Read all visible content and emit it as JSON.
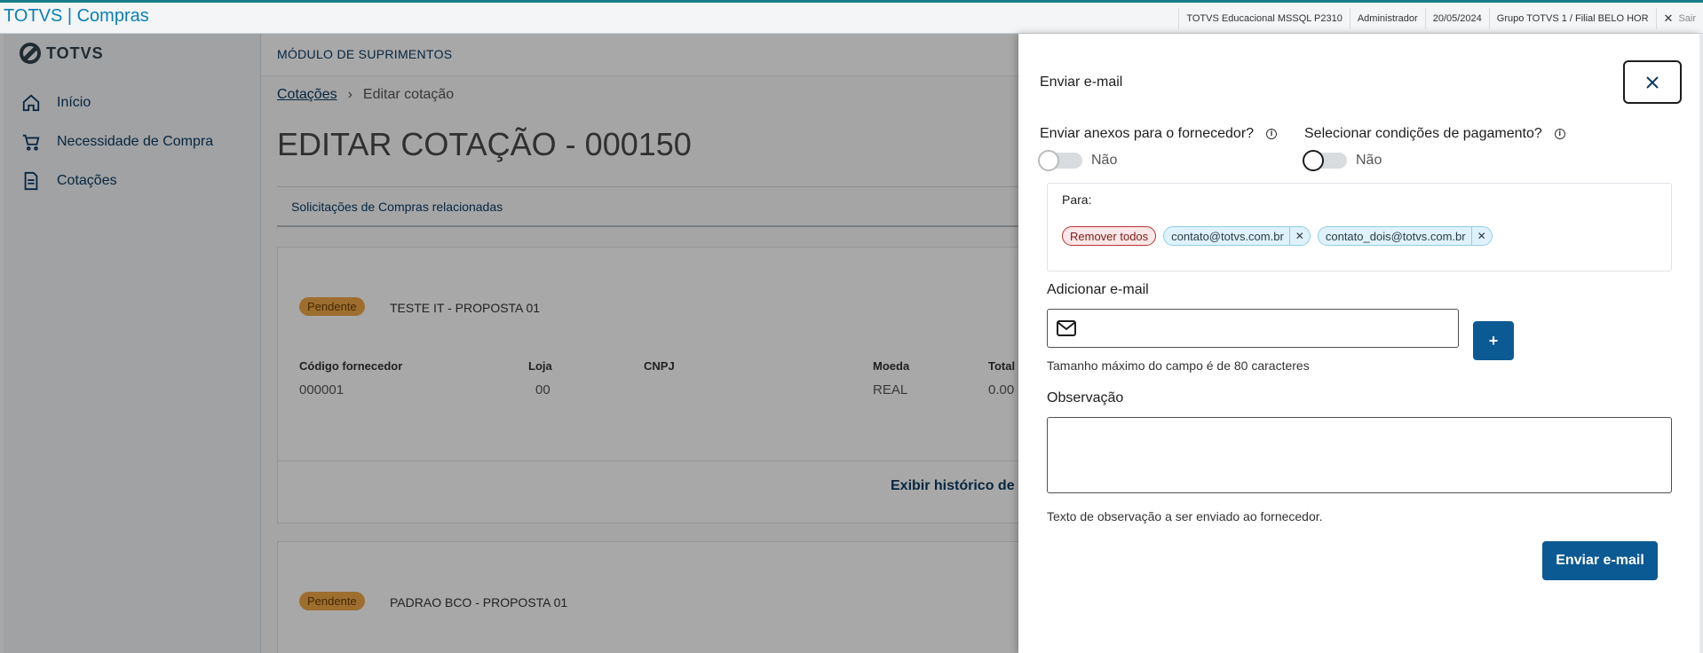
{
  "app": {
    "title": "TOTVS | Compras"
  },
  "status": {
    "environment": "TOTVS Educacional MSSQL P2310",
    "user": "Administrador",
    "date": "20/05/2024",
    "branch": "Grupo TOTVS 1 / Filial BELO HOR",
    "logout": "Sair"
  },
  "sidebar": {
    "logo": "TOTVS",
    "items": [
      {
        "label": "Início",
        "icon": "home-icon"
      },
      {
        "label": "Necessidade de Compra",
        "icon": "cart-icon"
      },
      {
        "label": "Cotações",
        "icon": "document-icon"
      }
    ]
  },
  "main": {
    "module": "MÓDULO DE SUPRIMENTOS",
    "breadcrumb": {
      "link": "Cotações",
      "current": "Editar cotação"
    },
    "title": "EDITAR COTAÇÃO - 000150",
    "tab": "Solicitações de Compras relacionadas",
    "proposals": [
      {
        "status": "Pendente",
        "name": "TESTE IT - PROPOSTA 01",
        "headers": [
          "Código fornecedor",
          "Loja",
          "CNPJ",
          "Moeda",
          "Total"
        ],
        "values": [
          "000001",
          "00",
          "",
          "REAL",
          "0.00"
        ],
        "history_link": "Exibir histórico de pr"
      },
      {
        "status": "Pendente",
        "name": "PADRAO BCO - PROPOSTA 01"
      }
    ]
  },
  "panel": {
    "title": "Enviar e-mail",
    "attachments": {
      "question": "Enviar anexos para o fornecedor?",
      "value": "Não"
    },
    "payment": {
      "question": "Selecionar condições de pagamento?",
      "value": "Não"
    },
    "to": {
      "label": "Para:",
      "remove_all": "Remover todos",
      "emails": [
        "contato@totvs.com.br",
        "contato_dois@totvs.com.br"
      ]
    },
    "add_email": {
      "label": "Adicionar e-mail",
      "value": "",
      "plus": "+",
      "hint": "Tamanho máximo do campo é de 80 caracteres"
    },
    "observation": {
      "label": "Observação",
      "value": "",
      "hint": "Texto de observação a ser enviado ao fornecedor."
    },
    "send_button": "Enviar e-mail"
  },
  "colors": {
    "primary": "#0c5a93",
    "badge": "#f0a848",
    "overlay": "rgba(0,0,0,0.34)"
  }
}
